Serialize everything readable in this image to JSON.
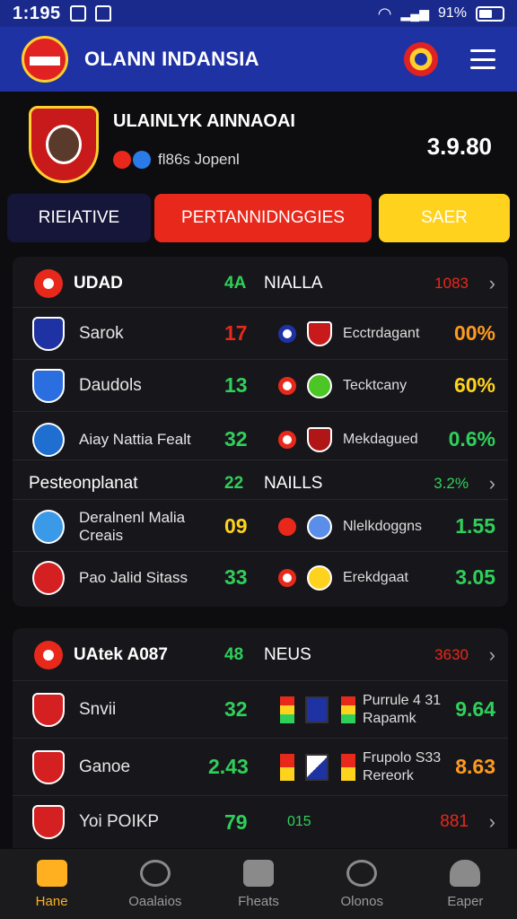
{
  "status_bar": {
    "time": "1:195",
    "battery": "91%"
  },
  "app_bar": {
    "title": "OLANN INDANSIA"
  },
  "team": {
    "name": "ULAINLYK AINNAOAI",
    "subtitle": "fl86s Jopenl",
    "score": "3.9.80"
  },
  "tabs": [
    {
      "label": "RIEIATIVE"
    },
    {
      "label": "PERTANNIDNGGIES"
    },
    {
      "label": "SAER"
    }
  ],
  "card1": {
    "header": {
      "title": "UDAD",
      "number": "4A",
      "label": "NIALLA",
      "right": "1083"
    },
    "rows": [
      {
        "team": "Sarok",
        "value": "17",
        "opponent": "Ecctrdagant",
        "pct": "00%"
      },
      {
        "team": "Daudols",
        "value": "13",
        "opponent": "Tecktcany",
        "pct": "60%"
      },
      {
        "team": "Aiay Nattia Fealt",
        "value": "32",
        "opponent": "Mekdagued",
        "pct": "0.6%"
      }
    ],
    "subheader": {
      "title": "Pesteonplanat",
      "number": "22",
      "label": "NAILLS",
      "right": "3.2%"
    },
    "subrows": [
      {
        "team": "Deralnenl Malia Creais",
        "value": "09",
        "opponent": "Nlelkdoggns",
        "pct": "1.55"
      },
      {
        "team": "Pao Jalid Sitass",
        "value": "33",
        "opponent": "Erekdgaat",
        "pct": "3.05"
      }
    ]
  },
  "card2": {
    "header": {
      "title": "UAtek A087",
      "number": "48",
      "label": "NEUS",
      "right": "3630"
    },
    "rows": [
      {
        "team": "Snvii",
        "value": "32",
        "opponent": "Purrule 4 31 Rapamk",
        "pct": "9.64"
      },
      {
        "team": "Ganoe",
        "value": "2.43",
        "opponent": "Frupolo S33 Rereork",
        "pct": "8.63"
      }
    ],
    "partial": {
      "team": "Yoi POIKP",
      "value": "79",
      "extra": "015",
      "right": "881"
    }
  },
  "bottom_nav": [
    {
      "label": "Hane"
    },
    {
      "label": "Oaalaios"
    },
    {
      "label": "Fheats"
    },
    {
      "label": "Olonos"
    },
    {
      "label": "Eaper"
    }
  ],
  "colors": {
    "brand": "#1f32a3",
    "accent_red": "#e8281b",
    "accent_yellow": "#ffd21e",
    "green": "#2fd05a",
    "orange": "#ff9a1f"
  }
}
